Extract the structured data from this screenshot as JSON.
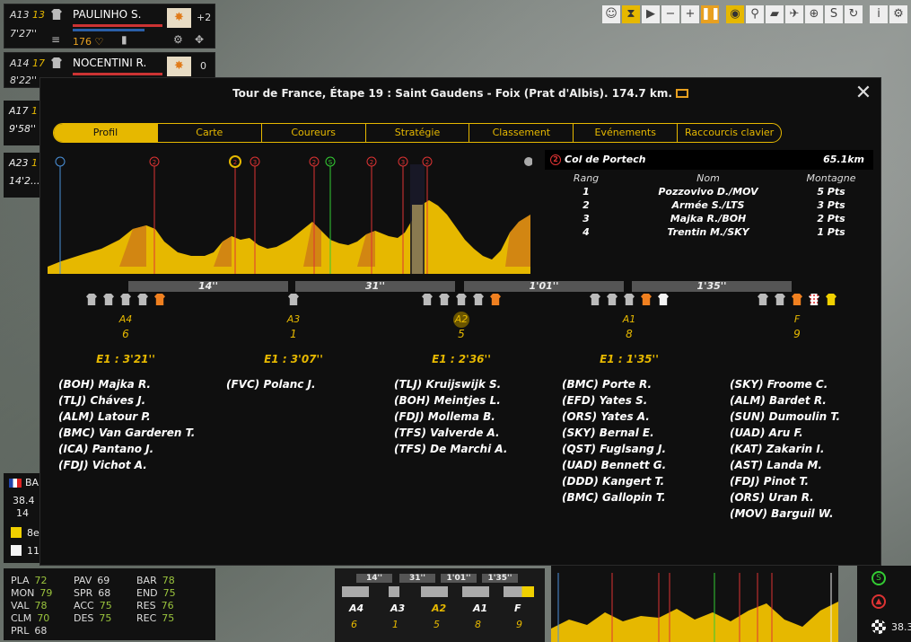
{
  "top_riders": [
    {
      "id": "A13",
      "pos": "13",
      "time": "7'27''",
      "name": "PAULINHO S.",
      "bonus": "+2",
      "energy": "176"
    },
    {
      "id": "A14",
      "pos": "17",
      "time": "8'22''",
      "name": "NOCENTINI R.",
      "bonus": "0"
    }
  ],
  "side_riders": [
    {
      "id": "A17",
      "pos": "1",
      "time": "9'58''"
    },
    {
      "id": "A23",
      "pos": "1",
      "time": "14'2..."
    }
  ],
  "toolbar": [
    "person-icon",
    "hourglass-icon",
    "play-icon",
    "minus-icon",
    "plus-icon",
    "pause-icon",
    "eye-icon",
    "motorbike-icon",
    "truck-icon",
    "helicopter-icon",
    "target-icon",
    "s-icon",
    "refresh-icon",
    "info-icon",
    "settings-icon"
  ],
  "flag_card": {
    "label": "BA",
    "speed": "38.4",
    "n": "14",
    "rank": "8e",
    "n2": "11"
  },
  "stats": [
    {
      "k": "PLA",
      "v": "72"
    },
    {
      "k": "PAV",
      "v": "69"
    },
    {
      "k": "BAR",
      "v": "78"
    },
    {
      "k": "MON",
      "v": "79"
    },
    {
      "k": "SPR",
      "v": "68"
    },
    {
      "k": "END",
      "v": "75"
    },
    {
      "k": "VAL",
      "v": "78"
    },
    {
      "k": "ACC",
      "v": "75"
    },
    {
      "k": "RES",
      "v": "76"
    },
    {
      "k": "CLM",
      "v": "70"
    },
    {
      "k": "DES",
      "v": "75"
    },
    {
      "k": "REC",
      "v": "75"
    },
    {
      "k": "PRL",
      "v": "68"
    }
  ],
  "dialog": {
    "title": "Tour de France, Étape 19 : Saint Gaudens - Foix (Prat d'Albis). 174.7 km.",
    "tabs": [
      "Profil",
      "Carte",
      "Coureurs",
      "Stratégie",
      "Classement",
      "Evénements",
      "Raccourcis clavier"
    ],
    "active_tab": "Profil",
    "climb": {
      "category": "2",
      "name": "Col de Portech",
      "km": "65.1km",
      "headers": [
        "Rang",
        "Nom",
        "Montagne"
      ],
      "rows": [
        [
          "1",
          "Pozzovivo D./MOV",
          "5 Pts"
        ],
        [
          "2",
          "Armée S./LTS",
          "3 Pts"
        ],
        [
          "3",
          "Majka R./BOH",
          "2 Pts"
        ],
        [
          "4",
          "Trentin M./SKY",
          "1 Pts"
        ]
      ]
    },
    "gaps": [
      "14''",
      "31''",
      "1'01''",
      "1'35''"
    ],
    "groups": [
      {
        "label": "A4",
        "count": "6",
        "gap": "E1 : 3'21''",
        "jerseys": [
          "g",
          "g",
          "g",
          "g",
          "orange"
        ],
        "highlight": false,
        "riders": [
          "(BOH) Majka R.",
          "(TLJ) Cháves J.",
          "(ALM) Latour P.",
          "(BMC) Van Garderen T.",
          "(ICA) Pantano J.",
          "(FDJ) Vichot A."
        ]
      },
      {
        "label": "A3",
        "count": "1",
        "gap": "E1 : 3'07''",
        "jerseys": [
          "g"
        ],
        "highlight": false,
        "riders": [
          "(FVC) Polanc J."
        ]
      },
      {
        "label": "A2",
        "count": "5",
        "gap": "E1 : 2'36''",
        "jerseys": [
          "g",
          "g",
          "g",
          "g",
          "orange"
        ],
        "highlight": true,
        "riders": [
          "(TLJ) Kruijswijk S.",
          "(BOH) Meintjes L.",
          "(FDJ) Mollema B.",
          "(TFS) Valverde A.",
          "(TFS) De Marchi A."
        ]
      },
      {
        "label": "A1",
        "count": "8",
        "gap": "E1 : 1'35''",
        "jerseys": [
          "g",
          "g",
          "g",
          "orange",
          "white"
        ],
        "highlight": false,
        "riders": [
          "(BMC) Porte R.",
          "(EFD) Yates S.",
          "(ORS) Yates A.",
          "(SKY) Bernal E.",
          "(QST) Fuglsang J.",
          "(UAD) Bennett G.",
          "(DDD) Kangert T.",
          "(BMC) Gallopin T."
        ]
      },
      {
        "label": "F",
        "count": "9",
        "gap": "",
        "jerseys": [
          "g",
          "g",
          "orange",
          "polka",
          "yellow"
        ],
        "highlight": false,
        "riders": [
          "(SKY) Froome C.",
          "(ALM) Bardet R.",
          "(SUN) Dumoulin T.",
          "(UAD) Aru F.",
          "(KAT) Zakarin I.",
          "(AST) Landa M.",
          "(FDJ) Pinot T.",
          "(ORS) Uran R.",
          "(MOV) Barguil W."
        ]
      }
    ],
    "profile_markers": [
      "start",
      "2",
      "2",
      "3",
      "2",
      "S",
      "2",
      "3",
      "2",
      "finish"
    ]
  },
  "mini": {
    "gaps": [
      "14''",
      "31''",
      "1'01''",
      "1'35''"
    ],
    "labels": [
      "A4",
      "A3",
      "A2",
      "A1",
      "F"
    ],
    "counts": [
      "6",
      "1",
      "5",
      "8",
      "9"
    ],
    "right_value": "38.3"
  },
  "colors": {
    "accent": "#e6b800",
    "climb_red": "#d33",
    "sprint_green": "#3c3"
  }
}
